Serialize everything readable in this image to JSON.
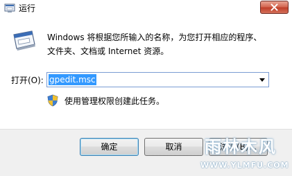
{
  "window": {
    "title": "运行",
    "close_icon": "close-icon"
  },
  "main": {
    "description_lines": [
      "Windows 将根据您所输入的名称，为您打开相应的程序、",
      "文件夹、文档或 Internet 资源。"
    ],
    "open_label": "打开(O):",
    "open_value": "gpedit.msc",
    "admin_note": "使用管理权限创建此任务。"
  },
  "buttons": {
    "ok": "确定",
    "cancel": "取消",
    "browse": "浏览(B)..."
  },
  "watermark": {
    "main": "雨林木风",
    "url": "WWW.YLMFU.COM"
  },
  "colors": {
    "selection": "#3399ff",
    "close_red": "#c0402a",
    "footer_bg": "#f0f0f0"
  }
}
